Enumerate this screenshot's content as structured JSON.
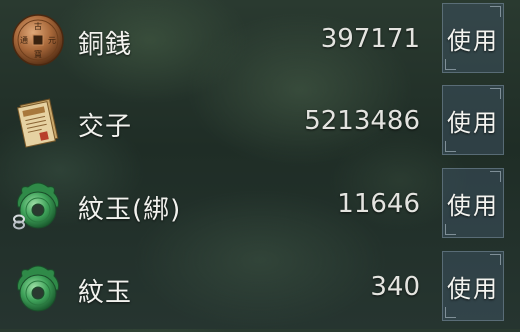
{
  "currencies": [
    {
      "name": "銅銭",
      "amount": "397171",
      "icon": "copper-coin-icon",
      "button_label": "使用"
    },
    {
      "name": "交子",
      "amount": "5213486",
      "icon": "paper-money-icon",
      "button_label": "使用"
    },
    {
      "name": "紋玉(綁)",
      "amount": "11646",
      "icon": "jade-bound-icon",
      "button_label": "使用"
    },
    {
      "name": "紋玉",
      "amount": "340",
      "icon": "jade-icon",
      "button_label": "使用"
    }
  ],
  "colors": {
    "button_bg": "#3c505f",
    "text": "#f2f2ee",
    "jade": "#3fa35a",
    "copper": "#a8683a"
  }
}
